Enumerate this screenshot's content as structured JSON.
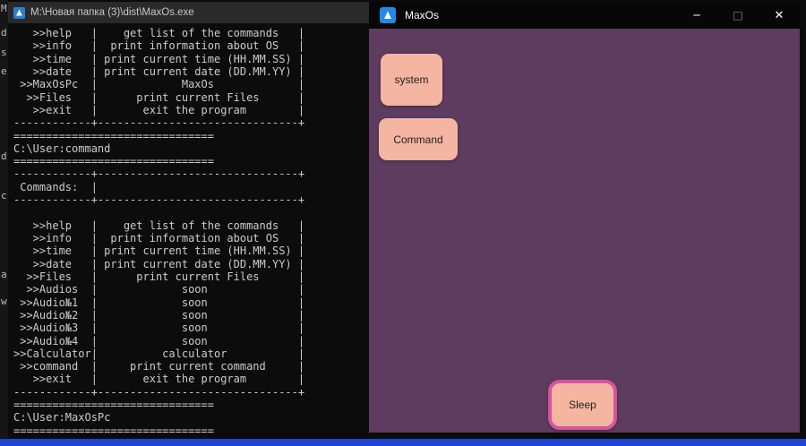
{
  "colors": {
    "console_bg": "#0c0c0c",
    "console_text": "#cccccc",
    "console_titlebar": "#2a2a2a",
    "app_titlebar": "#070707",
    "app_body_purple": "#5d3c5f",
    "button_fill_salmon": "#f4b5a1",
    "sleep_focus_border": "#d4549e",
    "taskbar_blue": "#1c46cf",
    "app_icon_blue": "#2488e8"
  },
  "left_edge": {
    "chars": [
      "M",
      "d",
      "s",
      "e",
      "d",
      "c",
      "a",
      "w"
    ]
  },
  "console": {
    "title": "M:\\Новая папка (3)\\dist\\MaxOs.exe",
    "lines": [
      "   >>help   |    get list of the commands   |",
      "   >>info   |  print information about OS   |",
      "   >>time   | print current time (HH.MM.SS) |",
      "   >>date   | print current date (DD.MM.YY) |",
      " >>MaxOsPc  |             MaxOs             |",
      "  >>Files   |      print current Files      |",
      "   >>exit   |       exit the program        |",
      "------------+-------------------------------+",
      "===============================",
      "C:\\User:command",
      "===============================",
      "------------+-------------------------------+",
      " Commands:  |",
      "------------+-------------------------------+",
      "",
      "   >>help   |    get list of the commands   |",
      "   >>info   |  print information about OS   |",
      "   >>time   | print current time (HH.MM.SS) |",
      "   >>date   | print current date (DD.MM.YY) |",
      "  >>Files   |      print current Files      |",
      "  >>Audios  |             soon              |",
      " >>Audio№1  |             soon              |",
      " >>Audio№2  |             soon              |",
      " >>Audio№3  |             soon              |",
      " >>Audio№4  |             soon              |",
      ">>Calculator|          calculator           |",
      " >>command  |     print current command     |",
      "   >>exit   |       exit the program        |",
      "------------+-------------------------------+",
      "===============================",
      "C:\\User:MaxOsPc",
      "==============================="
    ]
  },
  "app": {
    "title": "MaxOs",
    "controls": {
      "minimize": "─",
      "maximize": "□",
      "close": "✕"
    },
    "buttons": [
      {
        "label": "system"
      },
      {
        "label": "Command"
      },
      {
        "label": "Sleep",
        "state": "focused"
      }
    ]
  }
}
